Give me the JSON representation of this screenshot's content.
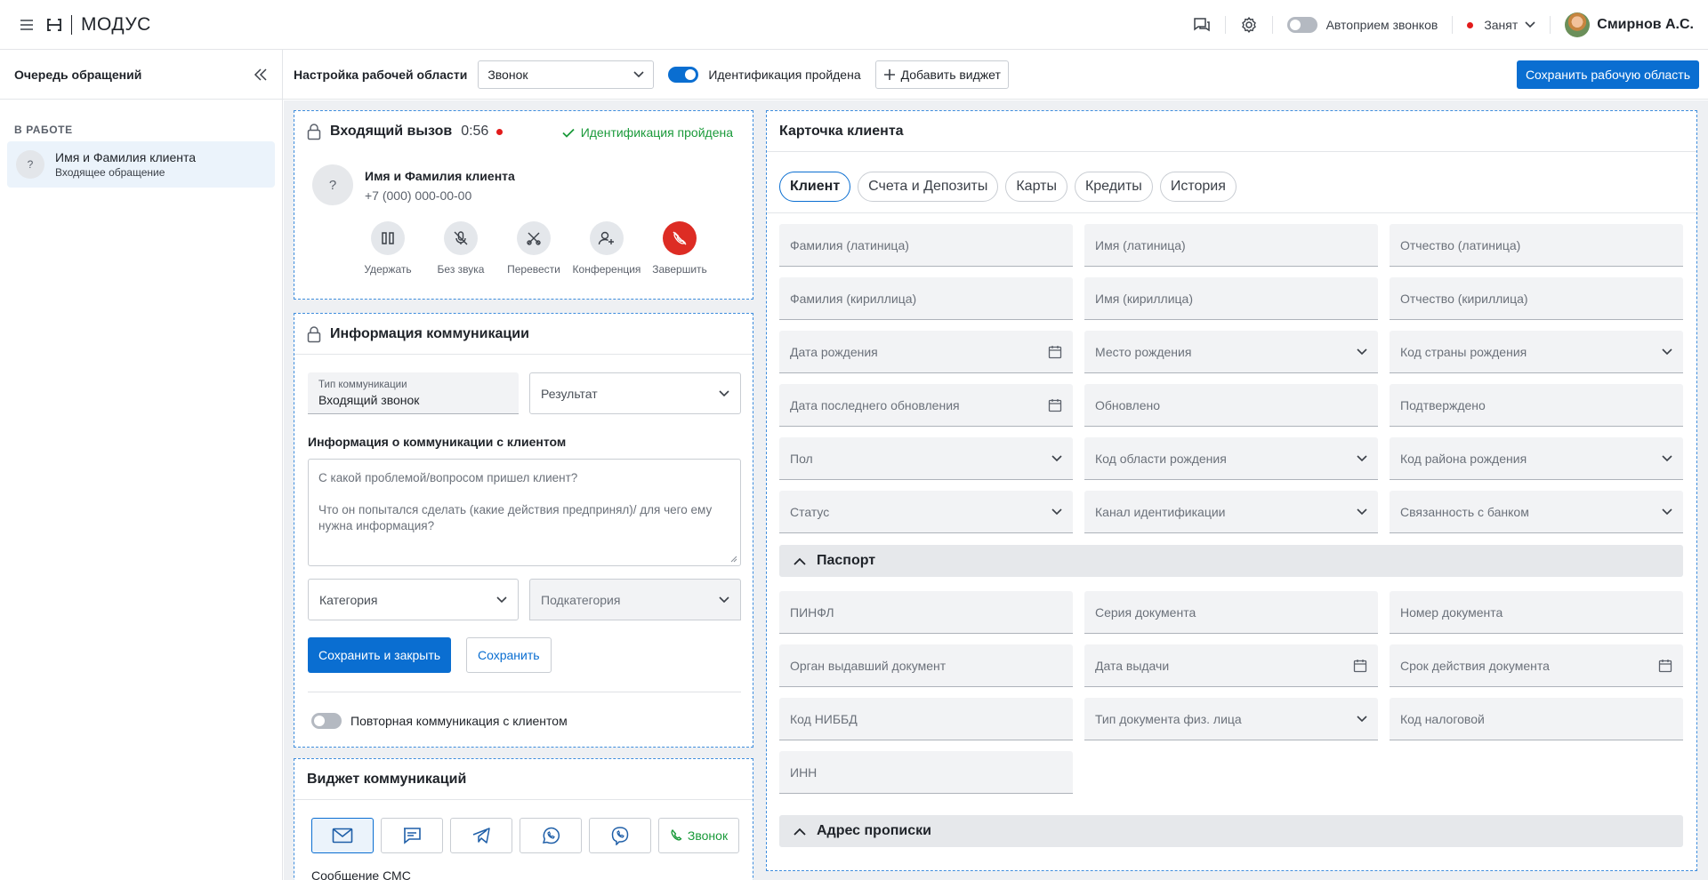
{
  "app": {
    "logo_text": "МОДУС"
  },
  "topbar": {
    "autoaccept_label": "Автоприем звонков",
    "status_label": "Занят",
    "user_name": "Смирнов А.С.",
    "status_color": "#e21b1b"
  },
  "sidebar": {
    "title": "Очередь обращений",
    "section_label": "В РАБОТЕ",
    "items": [
      {
        "avatar": "?",
        "name": "Имя и Фамилия клиента",
        "subtitle": "Входящее обращение"
      }
    ]
  },
  "workspace_toolbar": {
    "label": "Настройка рабочей области",
    "mode_value": "Звонок",
    "identification_label": "Идентификация пройдена",
    "add_widget_label": "Добавить виджет",
    "save_label": "Сохранить рабочую область"
  },
  "call_widget": {
    "title": "Входящий вызов",
    "timer": "0:56",
    "identified_label": "Идентификация пройдена",
    "caller_avatar": "?",
    "caller_name": "Имя и Фамилия клиента",
    "caller_phone": "+7 (000) 000-00-00",
    "actions": [
      {
        "label": "Удержать",
        "icon": "pause-icon"
      },
      {
        "label": "Без звука",
        "icon": "mic-off-icon"
      },
      {
        "label": "Перевести",
        "icon": "transfer-icon"
      },
      {
        "label": "Конференция",
        "icon": "add-person-icon"
      },
      {
        "label": "Завершить",
        "icon": "hangup-icon"
      }
    ],
    "accent_green": "#1a9a3a",
    "hangup_color": "#dd2c24"
  },
  "comm_info": {
    "title": "Информация коммуникации",
    "type_label": "Тип коммуникации",
    "type_value": "Входящий звонок",
    "result_placeholder": "Результат",
    "info_label": "Информация о коммуникации с клиентом",
    "textarea_line1": "С какой проблемой/вопросом пришел клиент?",
    "textarea_line2": "Что он попытался сделать (какие действия предпринял)/ для чего ему нужна информация?",
    "category_placeholder": "Категория",
    "subcategory_placeholder": "Подкатегория",
    "save_close_label": "Сохранить и закрыть",
    "save_label": "Сохранить",
    "repeat_label": "Повторная коммуникация с клиентом"
  },
  "comm_widget": {
    "title": "Виджет коммуникаций",
    "channels": [
      "mail-icon",
      "chat-icon",
      "telegram-icon",
      "whatsapp-icon",
      "viber-icon"
    ],
    "call_label": "Звонок",
    "sms_label": "Сообщение СМС"
  },
  "client_card": {
    "title": "Карточка клиента",
    "tabs": [
      "Клиент",
      "Счета и Депозиты",
      "Карты",
      "Кредиты",
      "История"
    ],
    "fields": [
      [
        "Фамилия (латиница)",
        "Имя (латиница)",
        "Отчество (латиница)"
      ],
      [
        "Фамилия (кириллица)",
        "Имя (кириллица)",
        "Отчество (кириллица)"
      ],
      [
        "Дата рождения",
        "Место рождения",
        "Код страны рождения"
      ],
      [
        "Дата последнего обновления",
        "Обновлено",
        "Подтверждено"
      ],
      [
        "Пол",
        "Код области рождения",
        "Код района рождения"
      ],
      [
        "Статус",
        "Канал идентификации",
        "Связанность с банком"
      ]
    ],
    "passport_title": "Паспорт",
    "passport_fields": [
      [
        "ПИНФЛ",
        "Серия документа",
        "Номер документа"
      ],
      [
        "Орган выдавший документ",
        "Дата выдачи",
        "Срок действия документа"
      ],
      [
        "Код НИББД",
        "Тип документа физ. лица",
        "Код налоговой"
      ],
      [
        "ИНН"
      ]
    ],
    "address_title": "Адрес прописки"
  }
}
